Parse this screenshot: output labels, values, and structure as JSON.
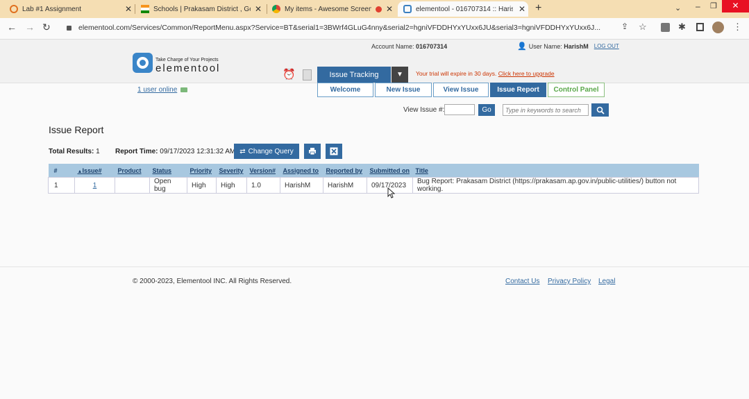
{
  "browser": {
    "tabs": [
      {
        "title": "Lab #1 Assignment",
        "active": false
      },
      {
        "title": "Schools | Prakasam District , Gov",
        "active": false
      },
      {
        "title": "My items - Awesome Screen",
        "active": false
      },
      {
        "title": "elementool - 016707314 :: Harish",
        "active": true
      }
    ],
    "url": "elementool.com/Services/Common/ReportMenu.aspx?Service=BT&serial1=3BWrf4GLuG4nny&serial2=hgniVFDDHYxYUxx6JU&serial3=hgniVFDDHYxYUxx6J..."
  },
  "header": {
    "logo_tagline": "Take Charge of Your Projects",
    "logo_name": "elementool",
    "account_label": "Account Name:",
    "account_value": "016707314",
    "user_label": "User Name:",
    "user_value": "HarishM",
    "logout": "LOG OUT",
    "service": "Issue Tracking",
    "trial_text": "Your trial will expire in 30 days.",
    "upgrade_link": "Click here to upgrade",
    "users_online": "1 user online"
  },
  "nav": {
    "tabs": [
      "Welcome",
      "New Issue",
      "View Issue",
      "Issue Report",
      "Control Panel"
    ]
  },
  "search": {
    "view_issue_label": "View Issue #:",
    "go": "Go",
    "placeholder": "Type in keywords to search"
  },
  "report": {
    "title": "Issue Report",
    "total_label": "Total Results:",
    "total_value": "1",
    "time_label": "Report Time:",
    "time_value": "09/17/2023 12:31:32 AM",
    "change_query": "Change Query",
    "columns": [
      "#",
      "Issue#",
      "Product",
      "Status",
      "Priority",
      "Severity",
      "Version#",
      "Assigned to",
      "Reported by",
      "Submitted on",
      "Title"
    ],
    "rows": [
      {
        "n": "1",
        "issue": "1",
        "product": "",
        "status": "Open bug",
        "priority": "High",
        "severity": "High",
        "version": "1.0",
        "assigned": "HarishM",
        "reported": "HarishM",
        "submitted": "09/17/2023",
        "title": "Bug Report: Prakasam District (https://prakasam.ap.gov.in/public-utilities/) button not working."
      }
    ]
  },
  "footer": {
    "copyright": "© 2000-2023, Elementool INC. All Rights Reserved.",
    "contact": "Contact Us",
    "privacy": "Privacy Policy",
    "legal": "Legal"
  },
  "colors": {
    "accent": "#336aa0",
    "tab_strip": "#f5deb3",
    "warn": "#cc3300"
  }
}
